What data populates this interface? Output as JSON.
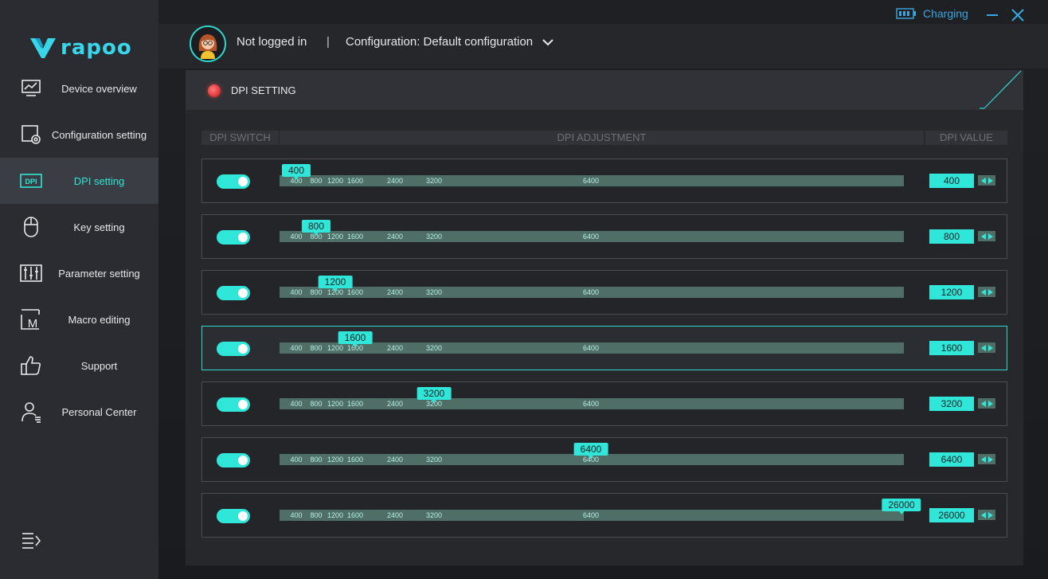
{
  "brand": {
    "logo_text": "rapoo",
    "accent": "#2fe6d8"
  },
  "titlebar": {
    "charging_label": "Charging",
    "minimize_icon": "minimize-icon",
    "close_icon": "close-icon"
  },
  "header": {
    "user_status": "Not logged in",
    "separator": "|",
    "config_label": "Configuration: Default configuration"
  },
  "sidebar": {
    "items": [
      {
        "label": "Device overview",
        "icon": "monitor-chart-icon",
        "active": false
      },
      {
        "label": "Configuration setting",
        "icon": "config-gear-icon",
        "active": false
      },
      {
        "label": "DPI setting",
        "icon": "dpi-icon",
        "active": true
      },
      {
        "label": "Key setting",
        "icon": "mouse-icon",
        "active": false
      },
      {
        "label": "Parameter setting",
        "icon": "sliders-icon",
        "active": false
      },
      {
        "label": "Macro editing",
        "icon": "macro-icon",
        "active": false
      },
      {
        "label": "Support",
        "icon": "thumbs-up-icon",
        "active": false
      },
      {
        "label": "Personal Center",
        "icon": "user-icon",
        "active": false
      }
    ],
    "dpi_icon_text": "DPI",
    "macro_icon_text": "M"
  },
  "panel": {
    "title": "DPI SETTING",
    "col_switch": "DPI SWITCH",
    "col_adjust": "DPI ADJUSTMENT",
    "col_value": "DPI VALUE"
  },
  "dpi_ticks": [
    "400",
    "800",
    "1200",
    "1600",
    "2400",
    "3200",
    "6400"
  ],
  "dpi_levels": [
    {
      "value": "400",
      "enabled": true,
      "highlight": false
    },
    {
      "value": "800",
      "enabled": true,
      "highlight": false
    },
    {
      "value": "1200",
      "enabled": true,
      "highlight": false
    },
    {
      "value": "1600",
      "enabled": true,
      "highlight": true
    },
    {
      "value": "3200",
      "enabled": true,
      "highlight": false
    },
    {
      "value": "6400",
      "enabled": true,
      "highlight": false
    },
    {
      "value": "26000",
      "enabled": true,
      "highlight": false
    }
  ]
}
